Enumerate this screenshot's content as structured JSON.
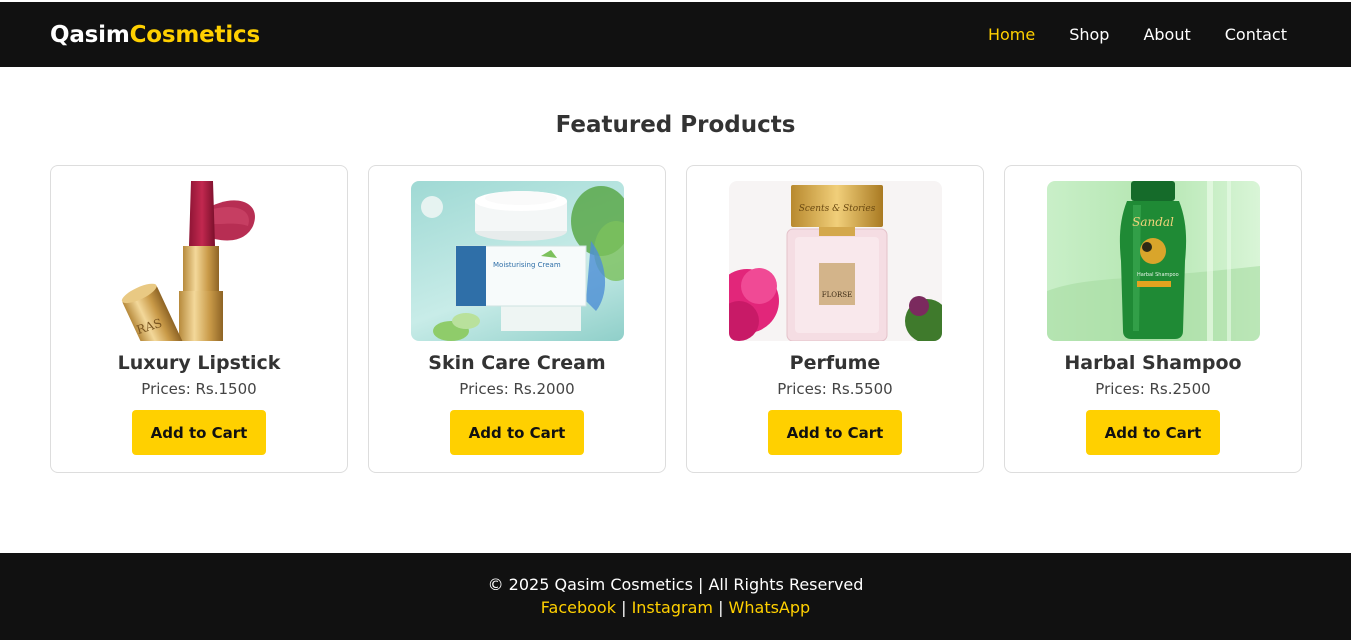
{
  "brand": {
    "part1": "Qasim",
    "part2": "Cosmetics"
  },
  "nav": {
    "home": "Home",
    "shop": "Shop",
    "about": "About",
    "contact": "Contact",
    "active": "Home"
  },
  "heading": "Featured Products",
  "products": [
    {
      "name": "Luxury Lipstick",
      "price": "Prices: Rs.1500",
      "button": "Add to Cart",
      "image": "lipstick-image"
    },
    {
      "name": "Skin Care Cream",
      "price": "Prices: Rs.2000",
      "button": "Add to Cart",
      "image": "cream-jar-image"
    },
    {
      "name": "Perfume",
      "price": "Prices: Rs.5500",
      "button": "Add to Cart",
      "image": "perfume-bottle-image"
    },
    {
      "name": "Harbal Shampoo",
      "price": "Prices: Rs.2500",
      "button": "Add to Cart",
      "image": "shampoo-bottle-image"
    }
  ],
  "image_text": {
    "lipstick_mark": "RAS",
    "cream_label": "Moisturising Cream",
    "perfume_brand": "Scents & Stories",
    "perfume_name": "FLORSE",
    "shampoo_brand": "Sandal",
    "shampoo_label": "Harbal Shampoo"
  },
  "footer": {
    "copyright": "© 2025 Qasim Cosmetics | All Rights Reserved",
    "facebook": "Facebook",
    "instagram": "Instagram",
    "whatsapp": "WhatsApp",
    "separator": "|"
  },
  "colors": {
    "accent": "#ffd000",
    "dark": "#111111",
    "text": "#333333"
  }
}
